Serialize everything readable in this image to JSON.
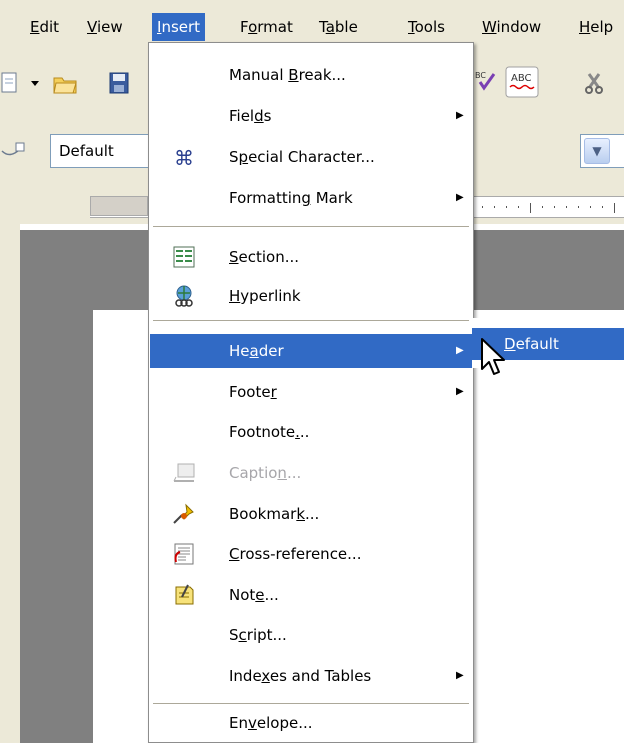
{
  "menubar": {
    "items": [
      {
        "pre": "",
        "key": "E",
        "post": "dit"
      },
      {
        "pre": "",
        "key": "V",
        "post": "iew"
      },
      {
        "pre": "",
        "key": "I",
        "post": "nsert"
      },
      {
        "pre": "F",
        "key": "o",
        "post": "rmat"
      },
      {
        "pre": "T",
        "key": "a",
        "post": "ble"
      },
      {
        "pre": "",
        "key": "T",
        "post": "ools"
      },
      {
        "pre": "",
        "key": "W",
        "post": "indow"
      },
      {
        "pre": "",
        "key": "H",
        "post": "elp"
      }
    ],
    "active": "Insert"
  },
  "toolbar": {
    "paragraph_style": "Default"
  },
  "insert_menu": {
    "items": [
      {
        "pre": "Manual ",
        "key": "B",
        "post": "reak...",
        "icon": "",
        "submenu": false
      },
      {
        "pre": "Fiel",
        "key": "d",
        "post": "s",
        "icon": "",
        "submenu": true
      },
      {
        "pre": "S",
        "key": "p",
        "post": "ecial Character...",
        "icon": "special-character-icon",
        "submenu": false
      },
      {
        "pre": "Formattin",
        "key": "g",
        "post": " Mark",
        "icon": "",
        "submenu": true
      },
      {
        "pre": "",
        "key": "S",
        "post": "ection...",
        "icon": "section-icon",
        "submenu": false
      },
      {
        "pre": "",
        "key": "H",
        "post": "yperlink",
        "icon": "hyperlink-icon",
        "submenu": false
      },
      {
        "pre": "He",
        "key": "a",
        "post": "der",
        "icon": "",
        "submenu": true
      },
      {
        "pre": "Foote",
        "key": "r",
        "post": "",
        "icon": "",
        "submenu": true
      },
      {
        "pre": "Footnote",
        "key": ".",
        "post": "..",
        "icon": "",
        "submenu": false
      },
      {
        "pre": "Captio",
        "key": "n",
        "post": "...",
        "icon": "caption-icon",
        "submenu": false
      },
      {
        "pre": "Bookmar",
        "key": "k",
        "post": "...",
        "icon": "bookmark-icon",
        "submenu": false
      },
      {
        "pre": "",
        "key": "C",
        "post": "ross-reference...",
        "icon": "cross-reference-icon",
        "submenu": false
      },
      {
        "pre": "Not",
        "key": "e",
        "post": "...",
        "icon": "note-icon",
        "submenu": false
      },
      {
        "pre": "S",
        "key": "c",
        "post": "ript...",
        "icon": "",
        "submenu": false
      },
      {
        "pre": "Inde",
        "key": "x",
        "post": "es and Tables",
        "icon": "",
        "submenu": true
      },
      {
        "pre": "En",
        "key": "v",
        "post": "elope...",
        "icon": "",
        "submenu": false
      }
    ],
    "highlighted": "Header",
    "disabled": [
      "Caption..."
    ]
  },
  "header_submenu": {
    "items": [
      {
        "pre": "",
        "key": "D",
        "post": "efault"
      }
    ]
  },
  "colors": {
    "highlight": "#316ac5",
    "menu_bg": "#ffffff",
    "chrome_bg": "#ece9d8",
    "disabled_text": "#a7a6aa"
  }
}
